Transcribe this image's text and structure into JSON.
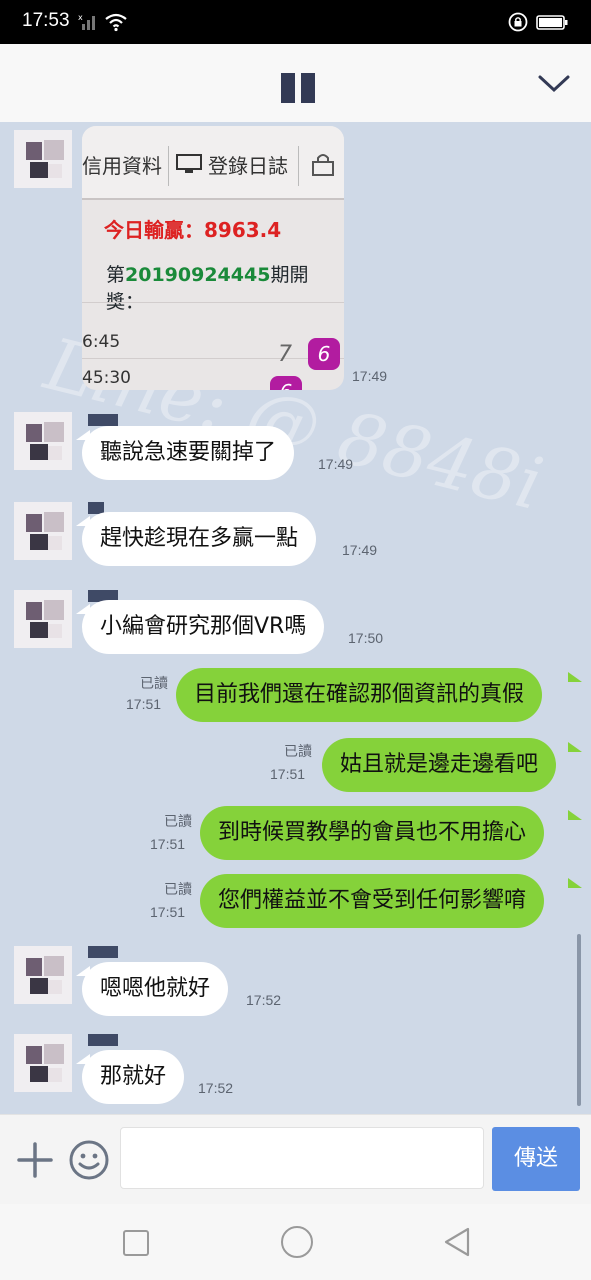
{
  "status_bar": {
    "time": "17:53"
  },
  "header": {
    "title_hidden": ""
  },
  "messages": {
    "photo_time": "17:49",
    "photo": {
      "tab1": "信用資料",
      "tab2": "登錄日誌",
      "line1": "今日輸贏：8963.4",
      "line2_prefix": "第",
      "line2_num": "20190924445",
      "line2_suffix": "期開獎：",
      "time1": "6:45",
      "time2": "45:30",
      "digit7": "7",
      "ball6": "6",
      "ball6b": "6"
    },
    "watermark": "Line: @ 8848i",
    "m1": {
      "text": "聽說急速要關掉了",
      "time": "17:49"
    },
    "m2": {
      "text": "趕快趁現在多贏一點",
      "time": "17:49"
    },
    "m3": {
      "text": "小編會研究那個VR嗎",
      "time": "17:50"
    },
    "m4": {
      "text": "目前我們還在確認那個資訊的真假",
      "read": "已讀",
      "time": "17:51"
    },
    "m5": {
      "text": "姑且就是邊走邊看吧",
      "read": "已讀",
      "time": "17:51"
    },
    "m6": {
      "text": "到時候買教學的會員也不用擔心",
      "read": "已讀",
      "time": "17:51"
    },
    "m7": {
      "text": "您們權益並不會受到任何影響唷",
      "read": "已讀",
      "time": "17:51"
    },
    "m8": {
      "text": "嗯嗯他就好",
      "time": "17:52"
    },
    "m9": {
      "text": "那就好",
      "time": "17:52"
    }
  },
  "input_bar": {
    "placeholder": "",
    "send_label": "傳送"
  },
  "colors": {
    "chat_bg": "#cfd9e7",
    "out_bubble": "#85d23a",
    "in_bubble": "#ffffff",
    "send_button": "#5b8ee3"
  },
  "icons": [
    "signal-icon",
    "wifi-icon",
    "lock-icon",
    "battery-icon",
    "chevron-down-icon",
    "plus-icon",
    "emoji-icon",
    "nav-recent-icon",
    "nav-home-icon",
    "nav-back-icon"
  ]
}
